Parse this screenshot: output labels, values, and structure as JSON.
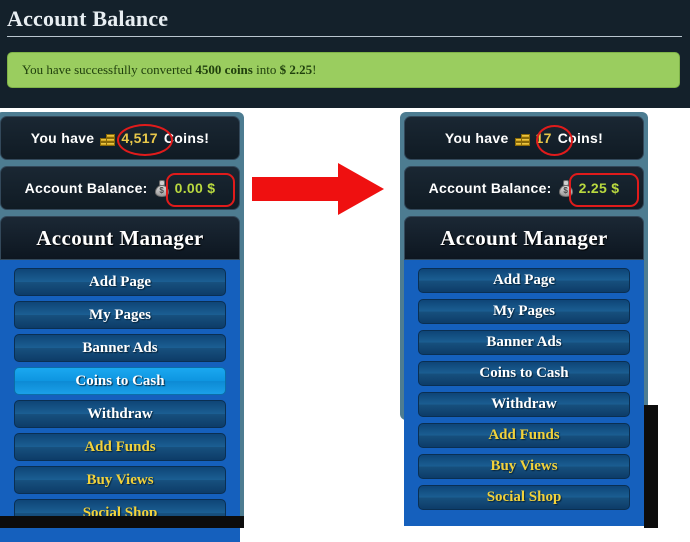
{
  "header": {
    "title": "Account Balance",
    "alert": {
      "prefix": "You have successfully converted ",
      "coins": "4500 coins",
      "middle": " into ",
      "amount": "$ 2.25",
      "suffix": "!"
    }
  },
  "icons": {
    "coins": "coins-stack-icon",
    "money_bag": "money-bag-icon",
    "bag_symbol": "$",
    "arrow": "red-right-arrow-icon"
  },
  "before_panel": {
    "coins_row": {
      "label_before": "You have",
      "value": "4,517",
      "label_after": "Coins!"
    },
    "balance_row": {
      "label": "Account Balance:",
      "value": "0.00 $"
    },
    "account_manager": {
      "title": "Account Manager",
      "items": [
        {
          "label": "Add Page",
          "style": "normal",
          "active": false
        },
        {
          "label": "My Pages",
          "style": "normal",
          "active": false
        },
        {
          "label": "Banner Ads",
          "style": "normal",
          "active": false
        },
        {
          "label": "Coins to Cash",
          "style": "normal",
          "active": true
        },
        {
          "label": "Withdraw",
          "style": "normal",
          "active": false
        },
        {
          "label": "Add Funds",
          "style": "gold",
          "active": false
        },
        {
          "label": "Buy Views",
          "style": "gold",
          "active": false
        },
        {
          "label": "Social Shop",
          "style": "gold",
          "active": false
        }
      ]
    }
  },
  "after_panel": {
    "coins_row": {
      "label_before": "You have",
      "value": "17",
      "label_after": "Coins!"
    },
    "balance_row": {
      "label": "Account Balance:",
      "value": "2.25 $"
    },
    "account_manager": {
      "title": "Account Manager",
      "items": [
        {
          "label": "Add Page",
          "style": "normal",
          "active": false
        },
        {
          "label": "My Pages",
          "style": "normal",
          "active": false
        },
        {
          "label": "Banner Ads",
          "style": "normal",
          "active": false
        },
        {
          "label": "Coins to Cash",
          "style": "normal",
          "active": false
        },
        {
          "label": "Withdraw",
          "style": "normal",
          "active": false
        },
        {
          "label": "Add Funds",
          "style": "gold",
          "active": false
        },
        {
          "label": "Buy Views",
          "style": "gold",
          "active": false
        },
        {
          "label": "Social Shop",
          "style": "gold",
          "active": false
        }
      ]
    }
  },
  "colors": {
    "page_background": "#14212b",
    "alert_background": "#9acd5f",
    "alert_text": "#20400d",
    "panel_border": "#4d7c91",
    "menu_background": "#1560bd",
    "menu_button": "#0e4577",
    "menu_button_active": "#0e95e0",
    "gold_text": "#f2d23b",
    "coin_value": "#e8c84a",
    "money_value": "#b9d93f",
    "annotation_red": "#e01b1b",
    "arrow_red": "#ef1010"
  }
}
